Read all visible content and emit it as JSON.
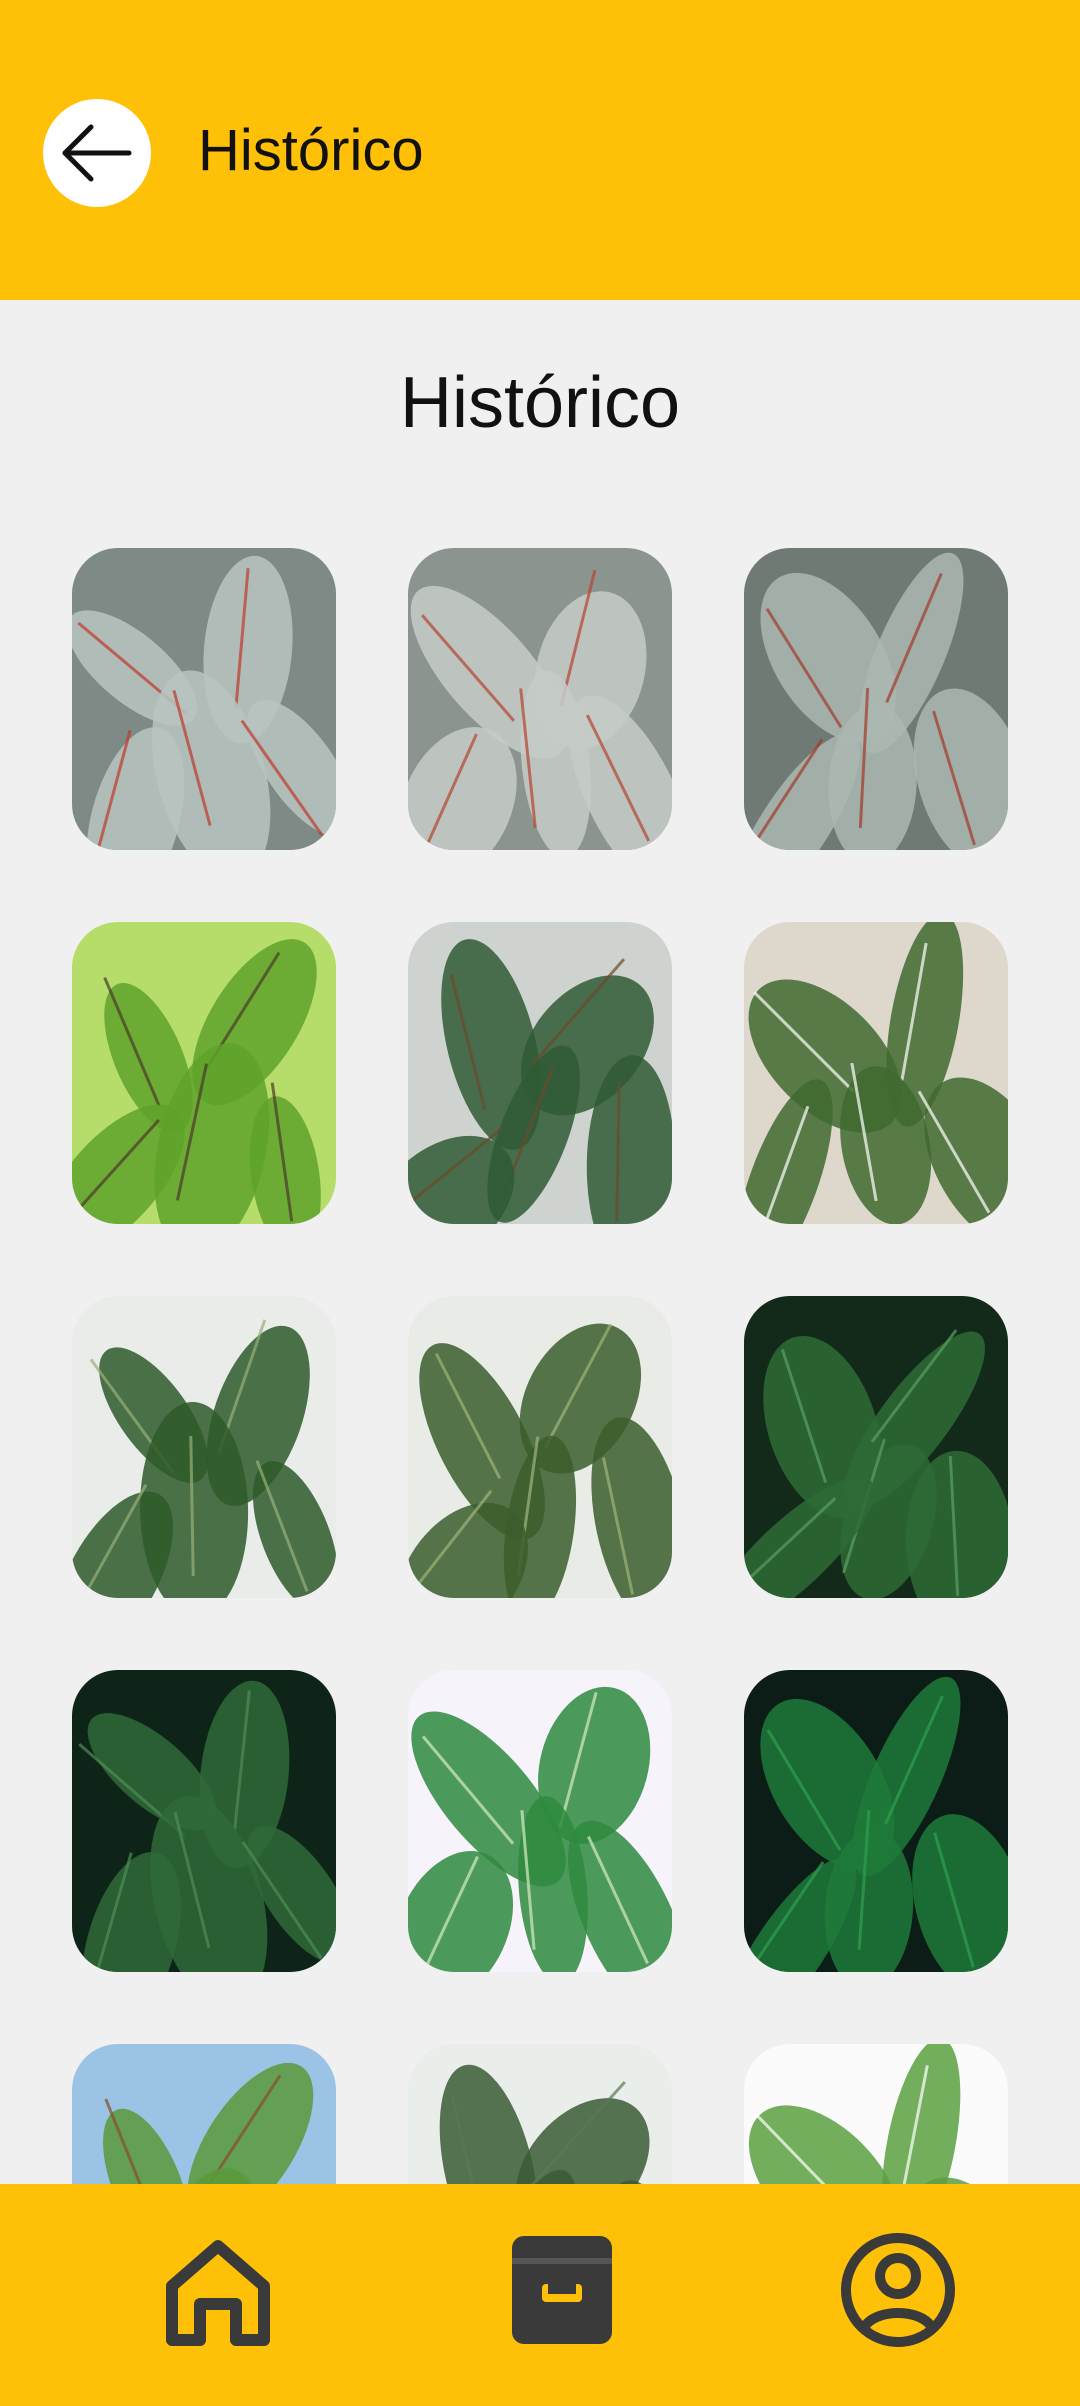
{
  "app_bar": {
    "title": "Histórico"
  },
  "page": {
    "title": "Histórico"
  },
  "colors": {
    "accent": "#ffc107",
    "background": "#f0f0f0",
    "icon": "#3a3a3a"
  },
  "icons": {
    "back": "arrow-left-icon",
    "nav_home": "home-icon",
    "nav_history": "archive-box-icon",
    "nav_profile": "user-circle-icon"
  },
  "history_items": [
    {
      "bg": "#7d8a85",
      "leaf": "#b9c4bf",
      "accent": "#c0392b"
    },
    {
      "bg": "#8c948f",
      "leaf": "#c5ccc8",
      "accent": "#b5452f"
    },
    {
      "bg": "#6f7a74",
      "leaf": "#aab8b1",
      "accent": "#a33a2a"
    },
    {
      "bg": "#b6dd6a",
      "leaf": "#5fa22a",
      "accent": "#4a3a2a"
    },
    {
      "bg": "#cfd3cf",
      "leaf": "#2f5b35",
      "accent": "#6b4a2a"
    },
    {
      "bg": "#ded8cc",
      "leaf": "#3f6a2f",
      "accent": "#ffffff"
    },
    {
      "bg": "#eaecea",
      "leaf": "#2e5a2a",
      "accent": "#98b07a"
    },
    {
      "bg": "#e8ebe6",
      "leaf": "#3b5e2c",
      "accent": "#9fb57a"
    },
    {
      "bg": "#13291a",
      "leaf": "#2e6b36",
      "accent": "#5aa060"
    },
    {
      "bg": "#0f2418",
      "leaf": "#2f6a3a",
      "accent": "#4e8d55"
    },
    {
      "bg": "#f7f3fa",
      "leaf": "#2e8a3e",
      "accent": "#d7ecc1"
    },
    {
      "bg": "#0b1d16",
      "leaf": "#1f7a3a",
      "accent": "#2fa050"
    },
    {
      "bg": "#9bc3e6",
      "leaf": "#5a9a3a",
      "accent": "#8b4a2a"
    },
    {
      "bg": "#e9eeea",
      "leaf": "#3a5a35",
      "accent": "#5a7a55"
    },
    {
      "bg": "#fbfbfb",
      "leaf": "#5aa040",
      "accent": "#ffffff"
    }
  ]
}
